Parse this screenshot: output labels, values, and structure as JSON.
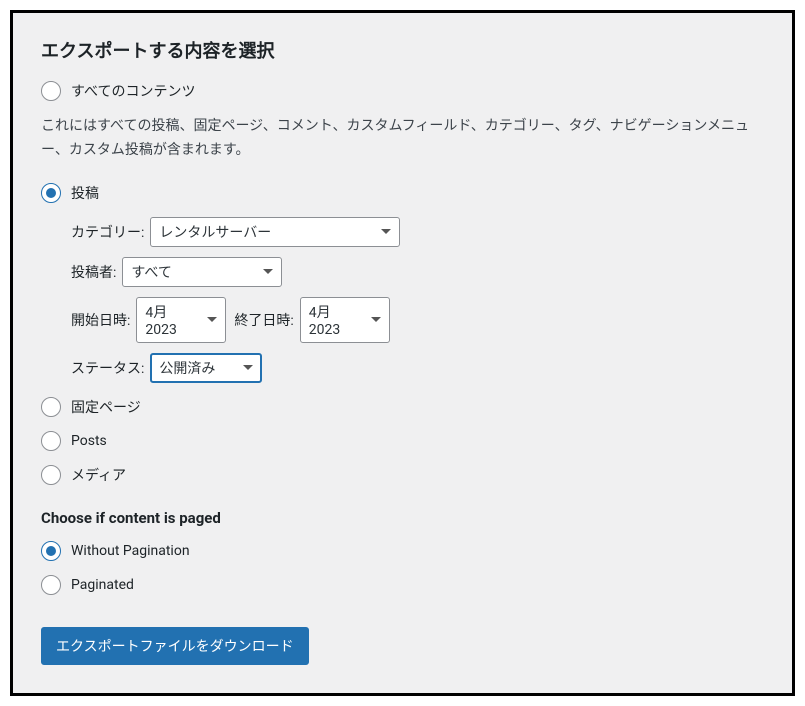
{
  "heading": "エクスポートする内容を選択",
  "options": {
    "all_content": {
      "label": "すべてのコンテンツ",
      "description": "これにはすべての投稿、固定ページ、コメント、カスタムフィールド、カテゴリー、タグ、ナビゲーションメニュー、カスタム投稿が含まれます。"
    },
    "posts": {
      "label": "投稿",
      "category_label": "カテゴリー:",
      "category_value": "レンタルサーバー",
      "author_label": "投稿者:",
      "author_value": "すべて",
      "start_date_label": "開始日時:",
      "start_date_value": "4月 2023",
      "end_date_label": "終了日時:",
      "end_date_value": "4月 2023",
      "status_label": "ステータス:",
      "status_value": "公開済み"
    },
    "pages": {
      "label": "固定ページ"
    },
    "cpt_posts": {
      "label": "Posts"
    },
    "media": {
      "label": "メディア"
    }
  },
  "pagination": {
    "heading": "Choose if content is paged",
    "without": "Without Pagination",
    "paginated": "Paginated"
  },
  "download_button": "エクスポートファイルをダウンロード"
}
